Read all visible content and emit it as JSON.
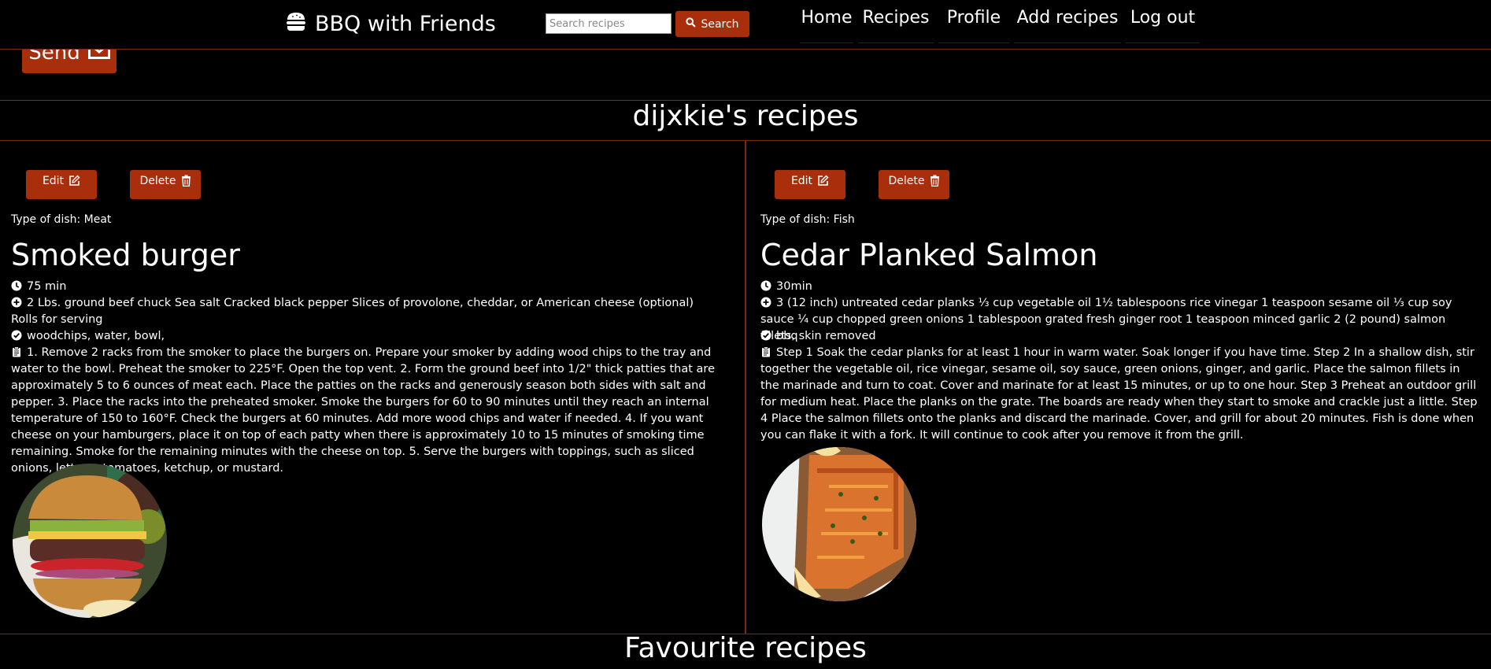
{
  "navbar": {
    "brand": "BBQ with Friends",
    "brand_icon": "burger-icon",
    "search": {
      "placeholder": "Search recipes",
      "value": "",
      "button_label": "Search",
      "button_icon": "search-icon"
    },
    "links": [
      "Home",
      "Recipes",
      "Profile",
      "Add recipes",
      "Log out"
    ]
  },
  "send_button": {
    "label": "Send",
    "icon": "envelope-icon"
  },
  "user_recipes_title": "dijxkie's recipes",
  "recipes": [
    {
      "edit_label": "Edit",
      "delete_label": "Delete",
      "type": "Type of dish: Meat",
      "title": "Smoked burger",
      "time": "75 min",
      "ingredients": "2 Lbs. ground beef chuck Sea salt Cracked black pepper Slices of provolone, cheddar, or American cheese (optional) Rolls for serving",
      "equipment": "woodchips, water, bowl,",
      "instructions": "1. Remove 2 racks from the smoker to place the burgers on. Prepare your smoker by adding wood chips to the tray and water to the bowl. Preheat the smoker to 225°F. Open the top vent. 2. Form the ground beef into 1/2\" thick patties that are approximately 5 to 6 ounces of meat each. Place the patties on the racks and generously season both sides with salt and pepper. 3. Place the racks into the preheated smoker. Smoke the burgers for 60 to 90 minutes until they reach an internal temperature of 150 to 160°F. Check the burgers at 60 minutes. Add more wood chips and water if needed. 4. If you want cheese on your hamburgers, place it on top of each patty when there is approximately 10 to 15 minutes of smoking time remaining. Smoke for the remaining minutes with the cheese on top. 5. Serve the burgers with toppings, such as sliced onions, lettuce, tomatoes, ketchup, or mustard."
    },
    {
      "edit_label": "Edit",
      "delete_label": "Delete",
      "type": "Type of dish: Fish",
      "title": "Cedar Planked Salmon",
      "time": "30min",
      "ingredients": "3 (12 inch) untreated cedar planks ⅓ cup vegetable oil 1½ tablespoons rice vinegar 1 teaspoon sesame oil ⅓ cup soy sauce ¼ cup chopped green onions 1 tablespoon grated fresh ginger root 1 teaspoon minced garlic 2 (2 pound) salmon fillets, skin removed",
      "equipment": "bbq",
      "instructions": "Step 1 Soak the cedar planks for at least 1 hour in warm water. Soak longer if you have time. Step 2 In a shallow dish, stir together the vegetable oil, rice vinegar, sesame oil, soy sauce, green onions, ginger, and garlic. Place the salmon fillets in the marinade and turn to coat. Cover and marinate for at least 15 minutes, or up to one hour. Step 3 Preheat an outdoor grill for medium heat. Place the planks on the grate. The boards are ready when they start to smoke and crackle just a little. Step 4 Place the salmon fillets onto the planks and discard the marinade. Cover, and grill for about 20 minutes. Fish is done when you can flake it with a fork. It will continue to cook after you remove it from the grill."
    }
  ],
  "favourites_title": "Favourite recipes",
  "colors": {
    "accent": "#a92e0c",
    "divider": "#7a2a12",
    "background": "#000000",
    "text": "#ffffff"
  }
}
